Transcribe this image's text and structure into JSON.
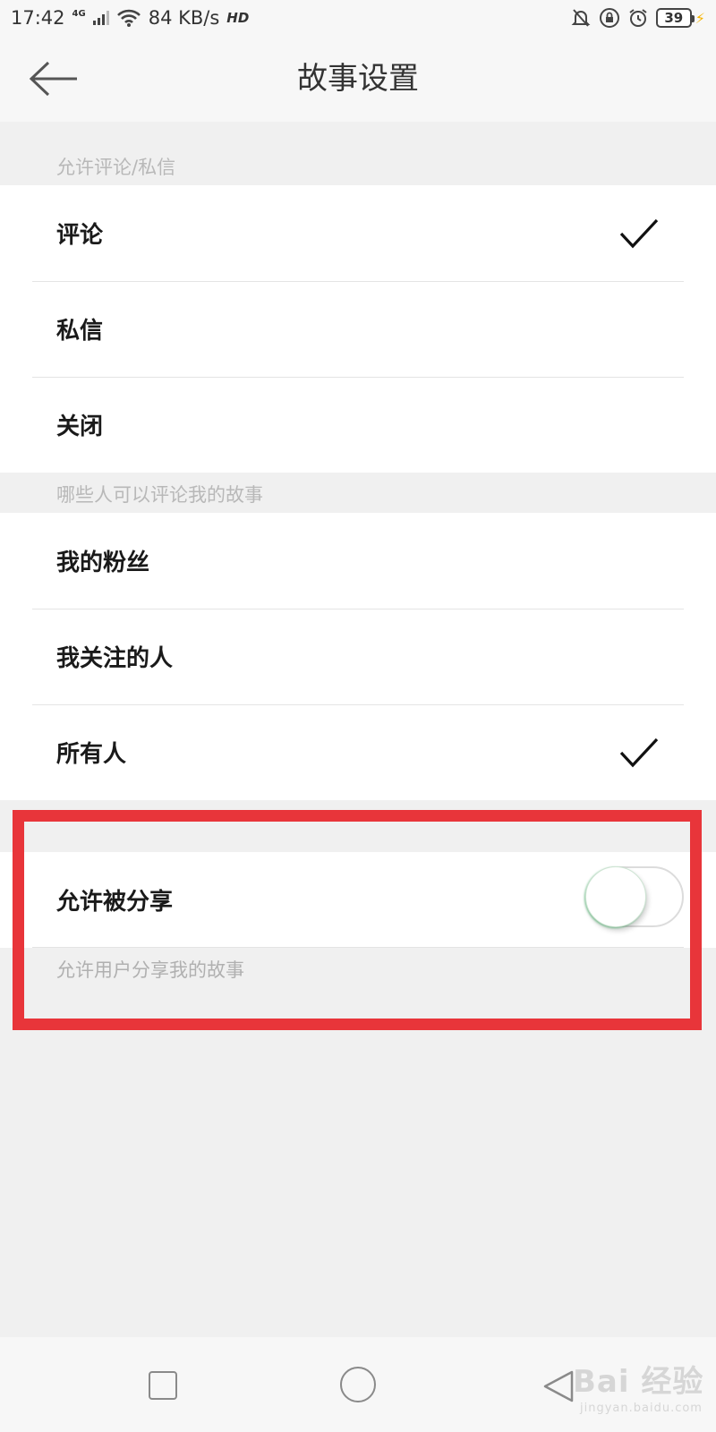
{
  "status_bar": {
    "time": "17:42",
    "network": "4G",
    "speed": "84 KB/s",
    "hd": "HD",
    "battery": "39",
    "icons": [
      "signal-icon",
      "wifi-icon",
      "mute-icon",
      "rotation-lock-icon",
      "alarm-icon",
      "battery-icon",
      "charging-icon"
    ]
  },
  "header": {
    "title": "故事设置",
    "back_icon": "arrow-left-icon"
  },
  "comment_section": {
    "label": "允许评论/私信",
    "options": [
      {
        "label": "评论",
        "selected": true
      },
      {
        "label": "私信",
        "selected": false
      },
      {
        "label": "关闭",
        "selected": false
      }
    ]
  },
  "audience_section": {
    "label": "哪些人可以评论我的故事",
    "options": [
      {
        "label": "我的粉丝",
        "selected": false
      },
      {
        "label": "我关注的人",
        "selected": false
      },
      {
        "label": "所有人",
        "selected": true
      }
    ]
  },
  "share_section": {
    "label": "允许被分享",
    "enabled": false,
    "caption": "允许用户分享我的故事"
  },
  "annotation": {
    "highlight_color": "#e8353a"
  },
  "nav_bar": {
    "icons": [
      "recent-apps-icon",
      "home-icon",
      "back-triangle-icon"
    ]
  },
  "watermark": {
    "text": "Bai 经验",
    "sub": "jingyan.baidu.com"
  }
}
